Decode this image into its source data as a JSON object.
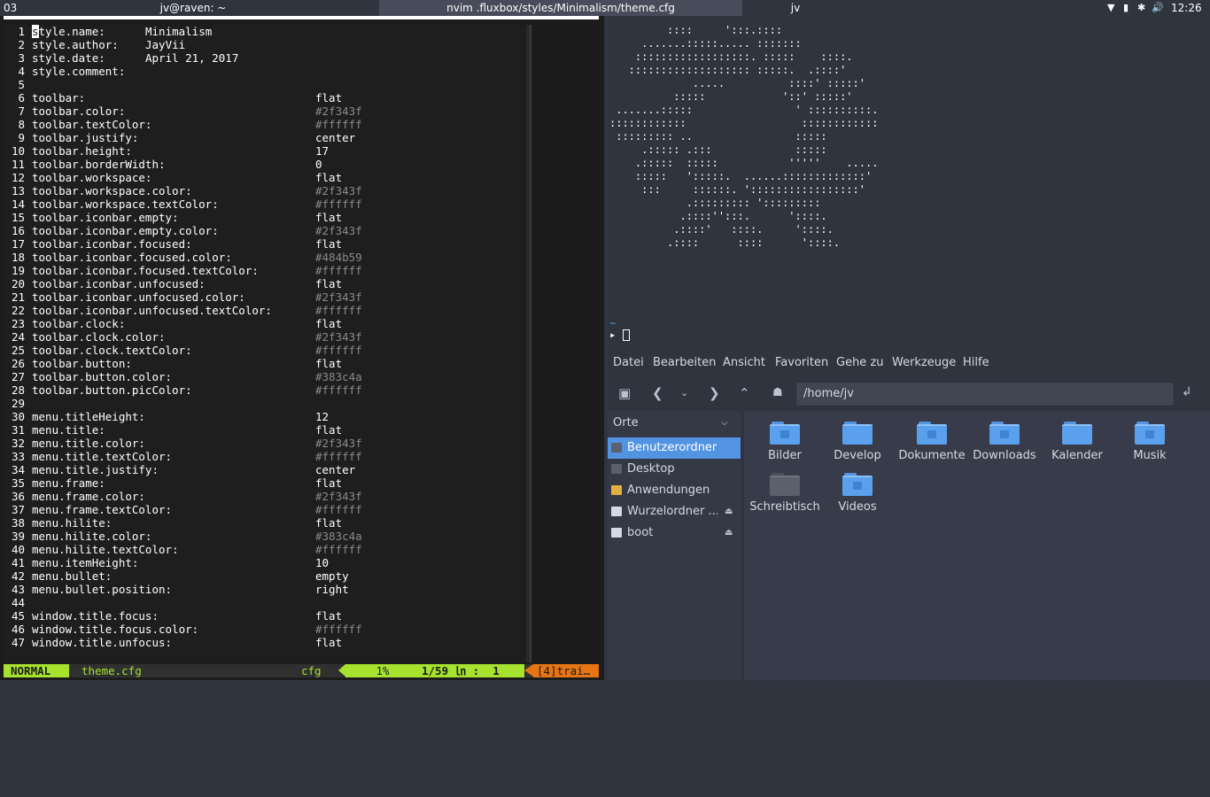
{
  "toolbar": {
    "workspace": "03",
    "tasks": [
      "jv@raven: ~",
      "nvim .fluxbox/styles/Minimalism/theme.cfg",
      "jv"
    ],
    "tray_icons": [
      "wifi-icon",
      "battery-icon",
      "bluetooth-icon",
      "volume-icon"
    ],
    "clock": "12:26"
  },
  "editor": {
    "lines": [
      {
        "n": "1",
        "key": "style.name:",
        "val": "Minimalism",
        "col": "short"
      },
      {
        "n": "2",
        "key": "style.author:",
        "val": "JayVii",
        "col": "short"
      },
      {
        "n": "3",
        "key": "style.date:",
        "val": "April 21, 2017",
        "col": "short"
      },
      {
        "n": "4",
        "key": "style.comment:",
        "val": "",
        "col": "short"
      },
      {
        "n": "5",
        "key": "",
        "val": "",
        "col": "long"
      },
      {
        "n": "6",
        "key": "toolbar:",
        "val": "flat",
        "col": "long"
      },
      {
        "n": "7",
        "key": "toolbar.color:",
        "val": "#2f343f",
        "col": "long"
      },
      {
        "n": "8",
        "key": "toolbar.textColor:",
        "val": "#ffffff",
        "col": "long"
      },
      {
        "n": "9",
        "key": "toolbar.justify:",
        "val": "center",
        "col": "long"
      },
      {
        "n": "10",
        "key": "toolbar.height:",
        "val": "17",
        "col": "long"
      },
      {
        "n": "11",
        "key": "toolbar.borderWidth:",
        "val": "0",
        "col": "long"
      },
      {
        "n": "12",
        "key": "toolbar.workspace:",
        "val": "flat",
        "col": "long"
      },
      {
        "n": "13",
        "key": "toolbar.workspace.color:",
        "val": "#2f343f",
        "col": "long"
      },
      {
        "n": "14",
        "key": "toolbar.workspace.textColor:",
        "val": "#ffffff",
        "col": "long"
      },
      {
        "n": "15",
        "key": "toolbar.iconbar.empty:",
        "val": "flat",
        "col": "long"
      },
      {
        "n": "16",
        "key": "toolbar.iconbar.empty.color:",
        "val": "#2f343f",
        "col": "long"
      },
      {
        "n": "17",
        "key": "toolbar.iconbar.focused:",
        "val": "flat",
        "col": "long"
      },
      {
        "n": "18",
        "key": "toolbar.iconbar.focused.color:",
        "val": "#484b59",
        "col": "long"
      },
      {
        "n": "19",
        "key": "toolbar.iconbar.focused.textColor:",
        "val": "#ffffff",
        "col": "long"
      },
      {
        "n": "20",
        "key": "toolbar.iconbar.unfocused:",
        "val": "flat",
        "col": "long"
      },
      {
        "n": "21",
        "key": "toolbar.iconbar.unfocused.color:",
        "val": "#2f343f",
        "col": "long"
      },
      {
        "n": "22",
        "key": "toolbar.iconbar.unfocused.textColor:",
        "val": "#ffffff",
        "col": "long"
      },
      {
        "n": "23",
        "key": "toolbar.clock:",
        "val": "flat",
        "col": "long"
      },
      {
        "n": "24",
        "key": "toolbar.clock.color:",
        "val": "#2f343f",
        "col": "long"
      },
      {
        "n": "25",
        "key": "toolbar.clock.textColor:",
        "val": "#ffffff",
        "col": "long"
      },
      {
        "n": "26",
        "key": "toolbar.button:",
        "val": "flat",
        "col": "long"
      },
      {
        "n": "27",
        "key": "toolbar.button.color:",
        "val": "#383c4a",
        "col": "long"
      },
      {
        "n": "28",
        "key": "toolbar.button.picColor:",
        "val": "#ffffff",
        "col": "long"
      },
      {
        "n": "29",
        "key": "",
        "val": "",
        "col": "long"
      },
      {
        "n": "30",
        "key": "menu.titleHeight:",
        "val": "12",
        "col": "long"
      },
      {
        "n": "31",
        "key": "menu.title:",
        "val": "flat",
        "col": "long"
      },
      {
        "n": "32",
        "key": "menu.title.color:",
        "val": "#2f343f",
        "col": "long"
      },
      {
        "n": "33",
        "key": "menu.title.textColor:",
        "val": "#ffffff",
        "col": "long"
      },
      {
        "n": "34",
        "key": "menu.title.justify:",
        "val": "center",
        "col": "long"
      },
      {
        "n": "35",
        "key": "menu.frame:",
        "val": "flat",
        "col": "long"
      },
      {
        "n": "36",
        "key": "menu.frame.color:",
        "val": "#2f343f",
        "col": "long"
      },
      {
        "n": "37",
        "key": "menu.frame.textColor:",
        "val": "#ffffff",
        "col": "long"
      },
      {
        "n": "38",
        "key": "menu.hilite:",
        "val": "flat",
        "col": "long"
      },
      {
        "n": "39",
        "key": "menu.hilite.color:",
        "val": "#383c4a",
        "col": "long"
      },
      {
        "n": "40",
        "key": "menu.hilite.textColor:",
        "val": "#ffffff",
        "col": "long"
      },
      {
        "n": "41",
        "key": "menu.itemHeight:",
        "val": "10",
        "col": "long"
      },
      {
        "n": "42",
        "key": "menu.bullet:",
        "val": "empty",
        "col": "long"
      },
      {
        "n": "43",
        "key": "menu.bullet.position:",
        "val": "right",
        "col": "long"
      },
      {
        "n": "44",
        "key": "",
        "val": "",
        "col": "long"
      },
      {
        "n": "45",
        "key": "window.title.focus:",
        "val": "flat",
        "col": "long"
      },
      {
        "n": "46",
        "key": "window.title.focus.color:",
        "val": "#ffffff",
        "col": "long"
      },
      {
        "n": "47",
        "key": "window.title.unfocus:",
        "val": "flat",
        "col": "long"
      }
    ]
  },
  "statusline": {
    "mode": "NORMAL",
    "filename": "theme.cfg",
    "filetype": "cfg",
    "percent": "1%",
    "position": "1/59 ㏑ :  1",
    "trailing": "[4]trai…"
  },
  "terminal": {
    "ascii_art": "         ::::     ':::.::::\n     .......:::::..... :::::::\n    ::::::::::::::::::. :::::    ::::.\n   ::::::::::::::::::: :::::.  .::::'\n             .....          ::::' :::::'\n          :::::            '::' :::::'\n .......:::::                ' ::::::::::.\n::::::::::::                  ::::::::::::\n ::::::::: ..                :::::\n     .::::: .:::             :::::\n    .:::::  :::::           '''''    .....\n    :::::   ':::::.  ......:::::::::::::'\n     :::     ::::::. ':::::::::::::::::'\n            .::::::::: ':::::::::\n           .::::'':::.      '::::.\n          .::::'   ::::.     '::::.\n         .::::      ::::      '::::.",
    "tilde": "~",
    "prompt_symbol": "▸"
  },
  "filemanager": {
    "menu": [
      "Datei",
      "Bearbeiten",
      "Ansicht",
      "Favoriten",
      "Gehe zu",
      "Werkzeuge",
      "Hilfe"
    ],
    "location": "/home/jv",
    "sidebar_header": "Orte",
    "places": [
      {
        "label": "Benutzerordner",
        "icon": "home-folder-icon",
        "active": true,
        "eject": false
      },
      {
        "label": "Desktop",
        "icon": "desktop-icon",
        "active": false,
        "eject": false
      },
      {
        "label": "Anwendungen",
        "icon": "applications-icon",
        "active": false,
        "eject": false
      },
      {
        "label": "Wurzelordner ...",
        "icon": "drive-icon",
        "active": false,
        "eject": true
      },
      {
        "label": "boot",
        "icon": "drive-icon",
        "active": false,
        "eject": true
      }
    ],
    "eject_glyph": "⏏",
    "folders": [
      {
        "label": "Bilder",
        "icon": "pictures-folder-icon"
      },
      {
        "label": "Develop",
        "icon": "folder-icon"
      },
      {
        "label": "Dokumente",
        "icon": "documents-folder-icon"
      },
      {
        "label": "Downloads",
        "icon": "downloads-folder-icon"
      },
      {
        "label": "Kalender",
        "icon": "folder-icon"
      },
      {
        "label": "Musik",
        "icon": "music-folder-icon"
      },
      {
        "label": "Schreibtisch",
        "icon": "desktop-folder-icon"
      },
      {
        "label": "Videos",
        "icon": "videos-folder-icon"
      }
    ]
  }
}
